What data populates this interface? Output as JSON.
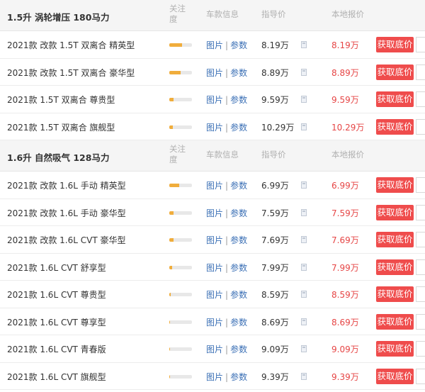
{
  "sections": [
    {
      "title": "1.5升 涡轮增压 180马力",
      "headers": {
        "attention": "关注度",
        "info": "车款信息",
        "guide_price": "指导价",
        "local_price": "本地报价"
      },
      "rows": [
        {
          "name": "2021款 改款 1.5T 双离合 精英型",
          "attention": 0.55,
          "pic": "图片",
          "sep": "|",
          "param": "参数",
          "guide": "8.19万",
          "local": "8.19万",
          "button": "获取底价"
        },
        {
          "name": "2021款 改款 1.5T 双离合 豪华型",
          "attention": 0.5,
          "pic": "图片",
          "sep": "|",
          "param": "参数",
          "guide": "8.89万",
          "local": "8.89万",
          "button": "获取底价"
        },
        {
          "name": "2021款 1.5T 双离合 尊贵型",
          "attention": 0.2,
          "pic": "图片",
          "sep": "|",
          "param": "参数",
          "guide": "9.59万",
          "local": "9.59万",
          "button": "获取底价"
        },
        {
          "name": "2021款 1.5T 双离合 旗舰型",
          "attention": 0.15,
          "pic": "图片",
          "sep": "|",
          "param": "参数",
          "guide": "10.29万",
          "local": "10.29万",
          "button": "获取底价"
        }
      ]
    },
    {
      "title": "1.6升 自然吸气 128马力",
      "headers": {
        "attention": "关注度",
        "info": "车款信息",
        "guide_price": "指导价",
        "local_price": "本地报价"
      },
      "rows": [
        {
          "name": "2021款 改款 1.6L 手动 精英型",
          "attention": 0.45,
          "pic": "图片",
          "sep": "|",
          "param": "参数",
          "guide": "6.99万",
          "local": "6.99万",
          "button": "获取底价"
        },
        {
          "name": "2021款 改款 1.6L 手动 豪华型",
          "attention": 0.2,
          "pic": "图片",
          "sep": "|",
          "param": "参数",
          "guide": "7.59万",
          "local": "7.59万",
          "button": "获取底价"
        },
        {
          "name": "2021款 改款 1.6L CVT 豪华型",
          "attention": 0.2,
          "pic": "图片",
          "sep": "|",
          "param": "参数",
          "guide": "7.69万",
          "local": "7.69万",
          "button": "获取底价"
        },
        {
          "name": "2021款 1.6L CVT 舒享型",
          "attention": 0.12,
          "pic": "图片",
          "sep": "|",
          "param": "参数",
          "guide": "7.99万",
          "local": "7.99万",
          "button": "获取底价"
        },
        {
          "name": "2021款 1.6L CVT 尊贵型",
          "attention": 0.06,
          "pic": "图片",
          "sep": "|",
          "param": "参数",
          "guide": "8.59万",
          "local": "8.59万",
          "button": "获取底价"
        },
        {
          "name": "2021款 1.6L CVT 尊享型",
          "attention": 0.04,
          "pic": "图片",
          "sep": "|",
          "param": "参数",
          "guide": "8.69万",
          "local": "8.69万",
          "button": "获取底价"
        },
        {
          "name": "2021款 1.6L CVT 青春版",
          "attention": 0.04,
          "pic": "图片",
          "sep": "|",
          "param": "参数",
          "guide": "9.09万",
          "local": "9.09万",
          "button": "获取底价"
        },
        {
          "name": "2021款 1.6L CVT 旗舰型",
          "attention": 0.04,
          "pic": "图片",
          "sep": "|",
          "param": "参数",
          "guide": "9.39万",
          "local": "9.39万",
          "button": "获取底价"
        }
      ]
    }
  ],
  "colors": {
    "accent_button": "#ef4c4c",
    "local_price": "#e64545",
    "link": "#3a6fb5",
    "attention_fill": "#f0ad3c"
  },
  "icons": {
    "calculator": "calculator-icon"
  }
}
